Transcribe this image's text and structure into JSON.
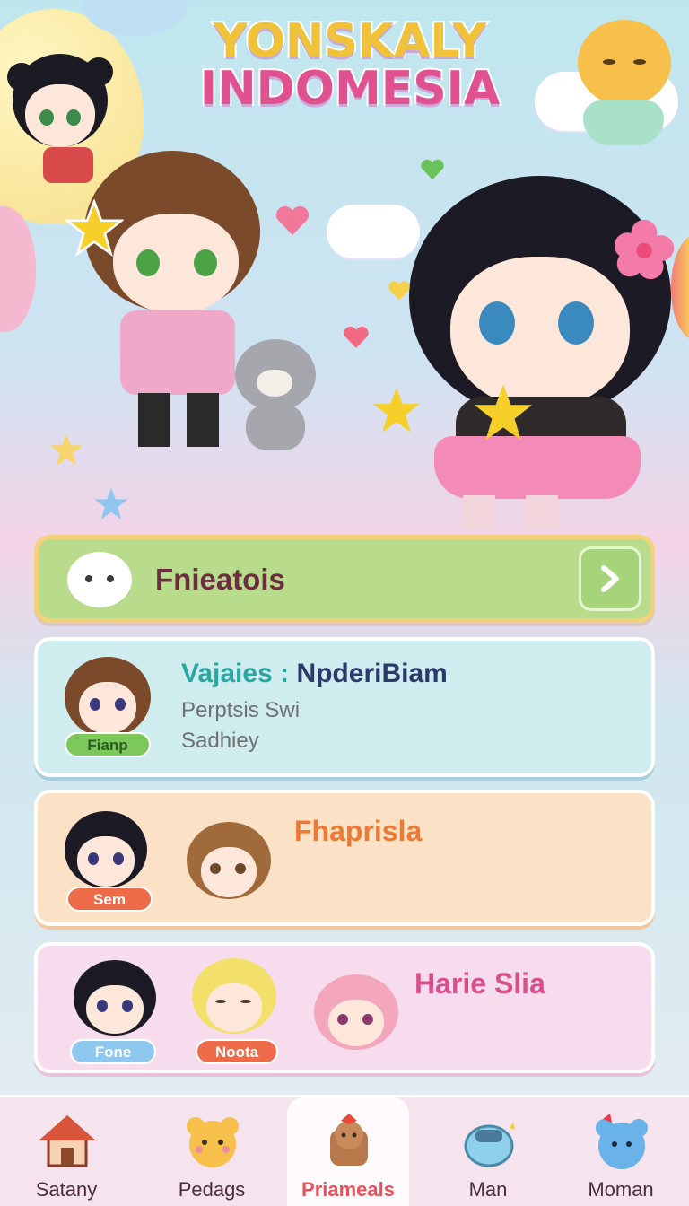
{
  "header": {
    "title_line1": "YONSKALY",
    "title_line2": "INDOMESIA"
  },
  "list": {
    "item1": {
      "title": "Fnieatois"
    },
    "item2": {
      "title_accent": "Vajaies :",
      "title_main": "NpderiBiam",
      "line1": "Perptsis Swi",
      "line2": "Sadhiey",
      "badge": "Fianp"
    },
    "item3": {
      "title": "Fhaprisla",
      "badge": "Sem"
    },
    "item4": {
      "title": "Harie Slia",
      "badge1": "Fone",
      "badge2": "Noota"
    }
  },
  "tabs": [
    {
      "label": "Satany",
      "icon": "house-icon"
    },
    {
      "label": "Pedags",
      "icon": "bear-face-icon"
    },
    {
      "label": "Priameals",
      "icon": "character-bag-icon",
      "active": true
    },
    {
      "label": "Man",
      "icon": "bath-tub-icon"
    },
    {
      "label": "Moman",
      "icon": "blue-bear-icon"
    }
  ],
  "colors": {
    "accent_green": "#b8dc8c",
    "accent_pink": "#d84f8c",
    "accent_orange": "#ec7a35",
    "active_tab": "#e9515d"
  }
}
